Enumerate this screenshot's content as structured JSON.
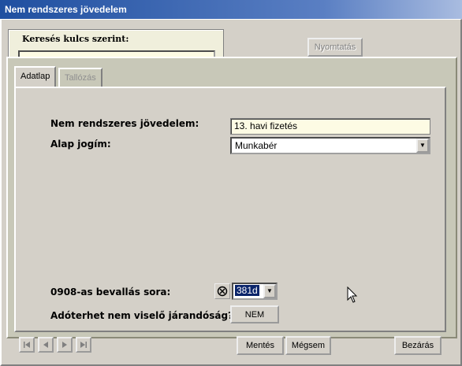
{
  "window": {
    "title": "Nem rendszeres jövedelem"
  },
  "search": {
    "legend": "Keresés kulcs szerint:",
    "value": ""
  },
  "toolbar": {
    "print_label": "Nyomtatás"
  },
  "tabs": [
    {
      "label": "Adatlap",
      "active": true
    },
    {
      "label": "Tallózás",
      "active": false
    }
  ],
  "form": {
    "income_label": "Nem rendszeres jövedelem:",
    "income_value": "13. havi fizetés",
    "basis_label": "Alap jogím:",
    "basis_value": "Munkabér",
    "row_label": "0908-as bevallás sora:",
    "row_value": "381d",
    "taxfree_label": "Adóterhet nem viselő járandóság?",
    "taxfree_value": "NEM"
  },
  "footer": {
    "save_label": "Mentés",
    "cancel_label": "Mégsem",
    "close_label": "Bezárás"
  },
  "icons": {
    "first": "first-record-icon",
    "prev": "previous-record-icon",
    "next": "next-record-icon",
    "last": "last-record-icon",
    "clear": "clear-circle-icon",
    "cursor": "mouse-pointer-icon"
  },
  "colors": {
    "title_bar": "#1f4fa0",
    "field_bg": "#fdfbe4",
    "selection": "#0a246a"
  }
}
